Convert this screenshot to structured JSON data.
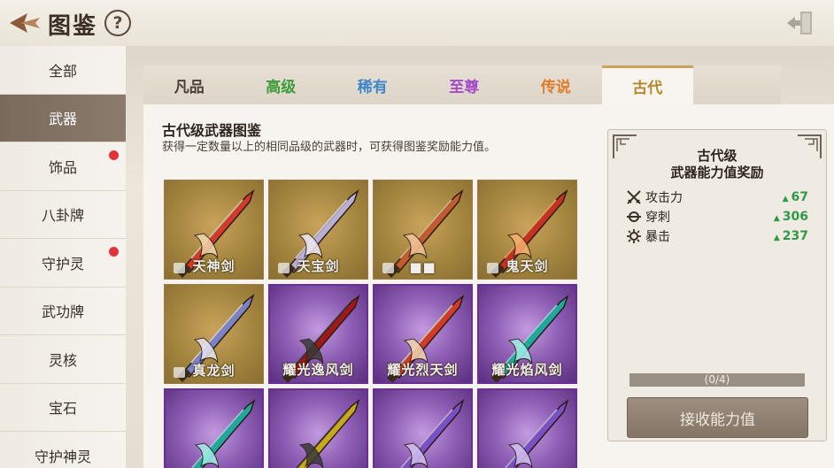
{
  "header": {
    "title": "图鉴",
    "help_label": "?"
  },
  "sidebar": {
    "items": [
      {
        "label": "全部",
        "active": false,
        "dot": false
      },
      {
        "label": "武器",
        "active": true,
        "dot": false
      },
      {
        "label": "饰品",
        "active": false,
        "dot": true
      },
      {
        "label": "八卦牌",
        "active": false,
        "dot": false
      },
      {
        "label": "守护灵",
        "active": false,
        "dot": true
      },
      {
        "label": "武功牌",
        "active": false,
        "dot": false
      },
      {
        "label": "灵核",
        "active": false,
        "dot": false
      },
      {
        "label": "宝石",
        "active": false,
        "dot": false
      },
      {
        "label": "守护神灵",
        "active": false,
        "dot": false
      }
    ]
  },
  "tabs": [
    {
      "label": "凡品",
      "color": "#4a3f35",
      "active": false
    },
    {
      "label": "高级",
      "color": "#3e9c3a",
      "active": false
    },
    {
      "label": "稀有",
      "color": "#3f86c8",
      "active": false
    },
    {
      "label": "至尊",
      "color": "#a54bc8",
      "active": false
    },
    {
      "label": "传说",
      "color": "#e07c2a",
      "active": false
    },
    {
      "label": "古代",
      "color": "#b8862c",
      "active": true
    }
  ],
  "main": {
    "title": "古代级武器图鉴",
    "description": "获得一定数量以上的相同品级的武器时，可获得图鉴奖励能力值。"
  },
  "cards": [
    {
      "name": "天神剑",
      "style": "gold",
      "blade": "red"
    },
    {
      "name": "天宝剑",
      "style": "gold",
      "blade": "silver"
    },
    {
      "name": "■■",
      "style": "gold",
      "blade": "orange"
    },
    {
      "name": "鬼天剑",
      "style": "gold",
      "blade": "crimson"
    },
    {
      "name": "真龙剑",
      "style": "gold",
      "blade": "blue"
    },
    {
      "name": "耀光逸风剑",
      "style": "purple",
      "blade": "dark-red"
    },
    {
      "name": "耀光烈天剑",
      "style": "purple",
      "blade": "red"
    },
    {
      "name": "耀光焰风剑",
      "style": "purple",
      "blade": "teal"
    },
    {
      "name": "",
      "style": "purple",
      "blade": "teal"
    },
    {
      "name": "",
      "style": "purple",
      "blade": "yellow"
    },
    {
      "name": "",
      "style": "purple",
      "blade": "violet"
    },
    {
      "name": "",
      "style": "purple",
      "blade": "violet"
    }
  ],
  "reward": {
    "title_line1": "古代级",
    "title_line2": "武器能力值奖励",
    "stats": [
      {
        "label": "攻击力",
        "value": "67",
        "icon": "crossed-swords-icon"
      },
      {
        "label": "穿刺",
        "value": "306",
        "icon": "pierce-icon"
      },
      {
        "label": "暴击",
        "value": "237",
        "icon": "gear-icon"
      }
    ],
    "progress_text": "(0/4)",
    "progress_fraction": 0,
    "claim_label": "接收能力值"
  }
}
